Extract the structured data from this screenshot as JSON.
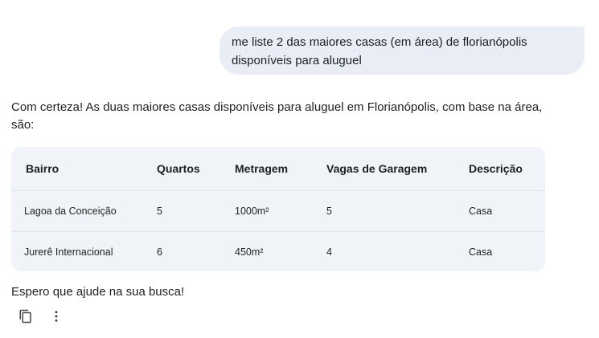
{
  "user_message": {
    "line1": "me liste 2 das maiores casas (em área) de florianópolis",
    "line2": "disponíveis para aluguel"
  },
  "response": {
    "intro": "Com certeza! As duas maiores casas disponíveis para aluguel em Florianópolis, com base na área, são:",
    "table": {
      "headers": [
        "Bairro",
        "Quartos",
        "Metragem",
        "Vagas de Garagem",
        "Descrição"
      ],
      "rows": [
        [
          "Lagoa da Conceição",
          "5",
          "1000m²",
          "5",
          "Casa"
        ],
        [
          "Jurerê Internacional",
          "6",
          "450m²",
          "4",
          "Casa"
        ]
      ]
    },
    "closing": "Espero que ajude na sua busca!"
  },
  "actions": {
    "copy_icon": "copy-icon",
    "more_icon": "more-vert-icon"
  }
}
